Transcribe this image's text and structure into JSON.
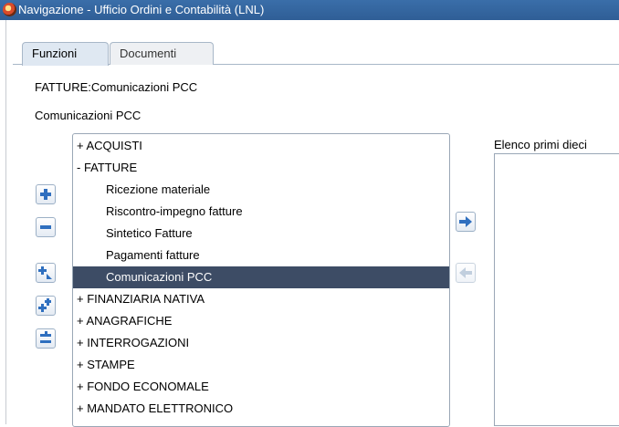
{
  "window": {
    "title": "Navigazione - Ufficio Ordini e Contabilità (LNL)"
  },
  "tabs": [
    {
      "label": "Funzioni",
      "active": true
    },
    {
      "label": "Documenti",
      "active": false
    }
  ],
  "path_label": "FATTURE:Comunicazioni PCC",
  "section_label": "Comunicazioni PCC",
  "tree": {
    "items": [
      {
        "text": "+ ACQUISTI",
        "level": 0
      },
      {
        "text": "- FATTURE",
        "level": 0
      },
      {
        "text": "Ricezione materiale",
        "level": 1
      },
      {
        "text": "Riscontro-impegno  fatture",
        "level": 1
      },
      {
        "text": "Sintetico Fatture",
        "level": 1
      },
      {
        "text": "Pagamenti fatture",
        "level": 1
      },
      {
        "text": "Comunicazioni PCC",
        "level": 1,
        "selected": true
      },
      {
        "text": "+ FINANZIARIA NATIVA",
        "level": 0
      },
      {
        "text": "+ ANAGRAFICHE",
        "level": 0
      },
      {
        "text": "+ INTERROGAZIONI",
        "level": 0
      },
      {
        "text": "+ STAMPE",
        "level": 0
      },
      {
        "text": "+ FONDO ECONOMALE",
        "level": 0
      },
      {
        "text": "+ MANDATO ELETTRONICO",
        "level": 0
      }
    ]
  },
  "side_buttons": {
    "expand": "plus-icon",
    "collapse": "minus-icon",
    "expand_all": "expand-all-icon",
    "expand_branch": "expand-branch-icon",
    "collapse_all": "collapse-all-icon"
  },
  "transfer_buttons": {
    "add": "arrow-right-icon",
    "remove": "arrow-left-icon"
  },
  "right_list": {
    "label": "Elenco primi dieci",
    "items": []
  },
  "colors": {
    "titlebar": "#2f5e96",
    "selection": "#3d4c65",
    "tab_active": "#dfe8f2",
    "icon_blue": "#2f6fbf"
  }
}
